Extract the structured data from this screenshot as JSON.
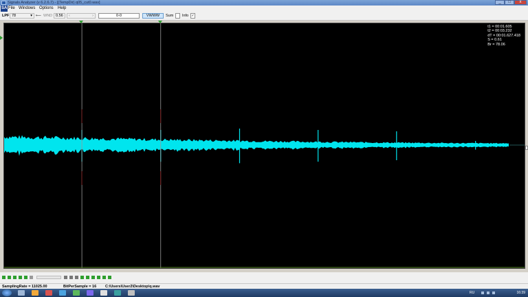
{
  "window": {
    "title": "Signals Analyzer (v 6.2.6.7) - [(TempDir) q05_cut0.wav]",
    "controls": [
      "_",
      "□",
      "x"
    ]
  },
  "menu": {
    "logo": "SA",
    "items": [
      "File",
      "Windows",
      "Options",
      "Help"
    ]
  },
  "toolbar": {
    "filter_label": "LPF",
    "filter_value": "78",
    "wnd_label": "WND",
    "wnd_value": "0.56",
    "range_value": "0-0",
    "mode_button": "VWWW",
    "sum_label": "Sum",
    "sum_checked": false,
    "info_label": "Info",
    "info_checked": true
  },
  "readout": {
    "t1": "t1 = 00:01.605",
    "t2": "t2 = 00:03.232",
    "dT": "dT = 00:01.627.418",
    "S": "S = 0.61",
    "Br": "Br = 78.06"
  },
  "cursors": {
    "t1_seconds": 1.605,
    "t2_seconds": 3.232,
    "duration_seconds": 10.43
  },
  "waveform": {
    "color": "#00e5ee",
    "spike_times_seconds": [
      1.605,
      3.232,
      4.86,
      6.48,
      8.1,
      9.73
    ]
  },
  "bottom_tools": {
    "icons": [
      "play-icon",
      "step-icon",
      "stop-icon",
      "zoom-in-icon",
      "zoom-out-icon",
      "record-icon",
      "slider",
      "copy-icon",
      "paste-icon",
      "cut-icon",
      "save-icon",
      "undo-icon",
      "redo-icon",
      "marker-icon",
      "marker-all-icon",
      "close-marker-icon"
    ]
  },
  "status": {
    "sampling": "SamplingRate = 11025.00",
    "bits": "BitPerSample = 16",
    "path": "C:\\Users\\User2\\Desktop\\q.wav"
  },
  "taskbar": {
    "lang": "RU",
    "clock": "16:39"
  }
}
